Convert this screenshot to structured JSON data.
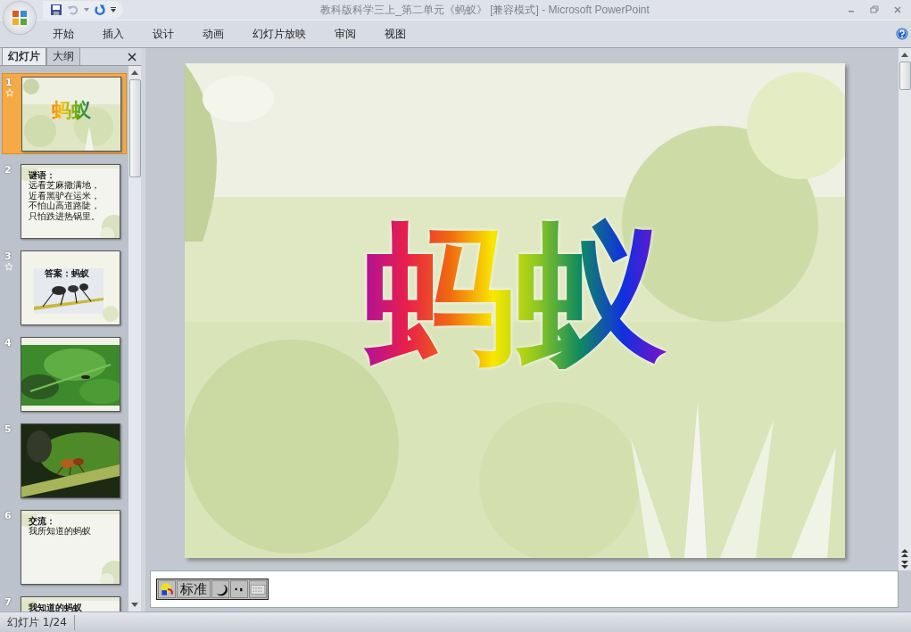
{
  "window": {
    "title": "教科版科学三上_第二单元《蚂蚁》 [兼容模式] - Microsoft PowerPoint"
  },
  "ribbon_tabs": [
    {
      "label": "开始"
    },
    {
      "label": "插入"
    },
    {
      "label": "设计"
    },
    {
      "label": "动画"
    },
    {
      "label": "幻灯片放映"
    },
    {
      "label": "审阅"
    },
    {
      "label": "视图"
    }
  ],
  "panel_tabs": [
    {
      "label": "幻灯片",
      "selected": true
    },
    {
      "label": "大纲",
      "selected": false
    }
  ],
  "slides": [
    {
      "number": "1",
      "selected": true,
      "animated": true,
      "kind": "title",
      "lines": [
        "蚂蚁"
      ]
    },
    {
      "number": "2",
      "selected": false,
      "animated": false,
      "kind": "text",
      "lines": [
        "谜语：",
        "远看芝麻撒满地，",
        "近看黑驴在运米，",
        "不怕山高道路陡，",
        "只怕跌进热锅里。"
      ]
    },
    {
      "number": "3",
      "selected": false,
      "animated": true,
      "kind": "captioned_photo",
      "lines": [
        "答案：蚂蚁"
      ]
    },
    {
      "number": "4",
      "selected": false,
      "animated": false
    },
    {
      "number": "5",
      "selected": false,
      "animated": false,
      "kind": "dark_photo"
    },
    {
      "number": "6",
      "selected": false,
      "animated": false,
      "kind": "text",
      "lines": [
        "交流：",
        "我所知道的蚂蚁"
      ]
    },
    {
      "number": "7",
      "selected": false,
      "animated": false,
      "kind": "text",
      "lines": [
        "我知道的蚂蚁"
      ]
    }
  ],
  "current_slide": {
    "title": "蚂蚁"
  },
  "ime_toolbar": {
    "mode": "标准"
  },
  "status_bar": {
    "slide_counter": "幻灯片 1/24"
  }
}
